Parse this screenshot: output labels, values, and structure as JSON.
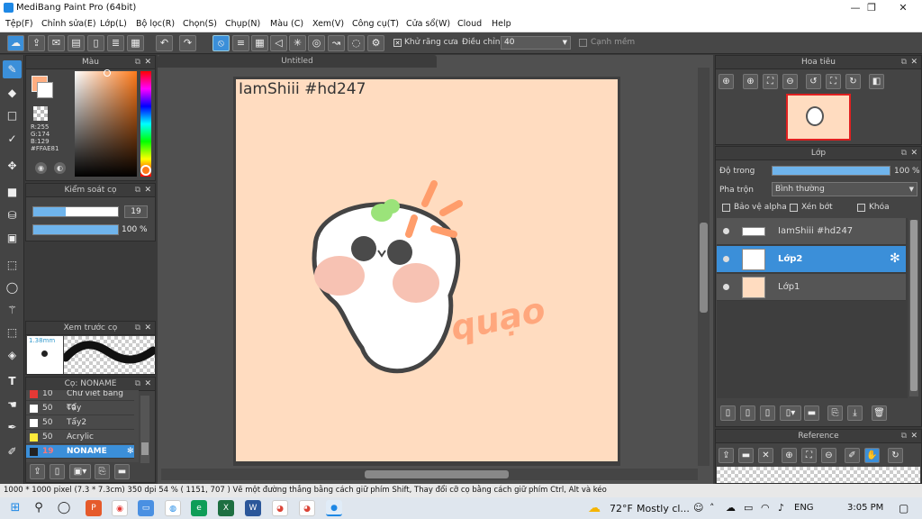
{
  "app": {
    "title": "MediBang Paint Pro (64bit)",
    "win_min": "—",
    "win_max": "❐",
    "win_close": "✕"
  },
  "menu": [
    "Tệp(F)",
    "Chỉnh sửa(E)",
    "Lớp(L)",
    "Bộ lọc(R)",
    "Chọn(S)",
    "Chụp(N)",
    "Màu (C)",
    "Xem(V)",
    "Công cụ(T)",
    "Cửa sổ(W)",
    "Cloud",
    "Help"
  ],
  "toolbar": {
    "antialias_label": "Khử răng cưa",
    "adjust_label": "Điều chỉnh",
    "adjust_value": "40",
    "smooth_label": "Cạnh mềm"
  },
  "color_panel": {
    "title": "Màu",
    "r": "R:255",
    "g": "G:174",
    "b": "B:129",
    "hex": "#FFAE81",
    "primary": "#FFAE81"
  },
  "brush_control": {
    "title": "Kiểm soát cọ",
    "size": "19",
    "opacity": "100 %",
    "size_fraction": 0.38,
    "opacity_fraction": 1.0
  },
  "brush_preview": {
    "title": "Xem trước cọ",
    "size_label": "1.38mm"
  },
  "brush_list": {
    "title": "Cọ: NONAME",
    "items": [
      {
        "size": "10",
        "name": "Chữ viết bằng cọ",
        "color": "#e53935"
      },
      {
        "size": "50",
        "name": "Tẩy",
        "color": "#ffffff"
      },
      {
        "size": "50",
        "name": "Tẩy2",
        "color": "#ffffff"
      },
      {
        "size": "50",
        "name": "Acrylic",
        "color": "#ffeb3b"
      },
      {
        "size": "19",
        "name": "NONAME",
        "color": "#222222"
      }
    ]
  },
  "document": {
    "tab": "Untitled",
    "text": "IamShiii #hd247",
    "sticker_text": "quạo"
  },
  "navigator": {
    "title": "Hoa tiêu"
  },
  "layer_panel": {
    "title": "Lớp",
    "opacity_label": "Độ trong",
    "opacity_value": "100 %",
    "opacity_fraction": 1.0,
    "blend_label": "Pha trộn",
    "blend_value": "Bình thường",
    "protect_alpha": "Bảo vệ alpha",
    "clipping": "Xén bớt",
    "lock": "Khóa",
    "layers": [
      {
        "name": "IamShiii #hd247",
        "selected": false
      },
      {
        "name": "Lớp2",
        "selected": true
      },
      {
        "name": "Lớp1",
        "selected": false
      }
    ]
  },
  "reference": {
    "title": "Reference"
  },
  "status": {
    "text": "1000 * 1000 pixel    (7.3 * 7.3cm)    350 dpi    54 %    ( 1151, 707 )    Vẽ một đường thẳng bằng cách giữ phím Shift, Thay đổi cỡ cọ bằng cách giữ phím Ctrl, Alt và kéo"
  },
  "taskbar": {
    "weather_temp": "72°F",
    "weather_text": "Mostly cl...",
    "lang": "ENG",
    "time": "3:05 PM"
  }
}
